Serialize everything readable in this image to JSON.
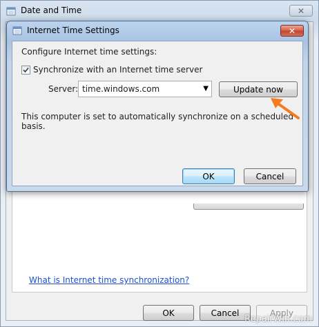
{
  "parent_window": {
    "title": "Date and Time",
    "close_glyph": "✕",
    "help_link": "What is Internet time synchronization?",
    "buttons": {
      "ok": "OK",
      "cancel": "Cancel",
      "apply": "Apply"
    }
  },
  "dialog": {
    "title": "Internet Time Settings",
    "close_glyph": "✕",
    "heading": "Configure Internet time settings:",
    "sync_checkbox": {
      "label": "Synchronize with an Internet time server",
      "checked": true
    },
    "server": {
      "label": "Server:",
      "value": "time.windows.com"
    },
    "update_button": "Update now",
    "status": "This computer is set to automatically synchronize on a scheduled basis.",
    "buttons": {
      "ok": "OK",
      "cancel": "Cancel"
    }
  },
  "annotation": {
    "arrow_color": "#f47b20"
  },
  "watermark": "RepairWin.com",
  "icons": {
    "app": "calendar-clock-icon",
    "close": "close-icon",
    "check": "checkmark-icon",
    "dropdown": "chevron-down-icon",
    "arrow": "pointer-arrow-icon"
  }
}
